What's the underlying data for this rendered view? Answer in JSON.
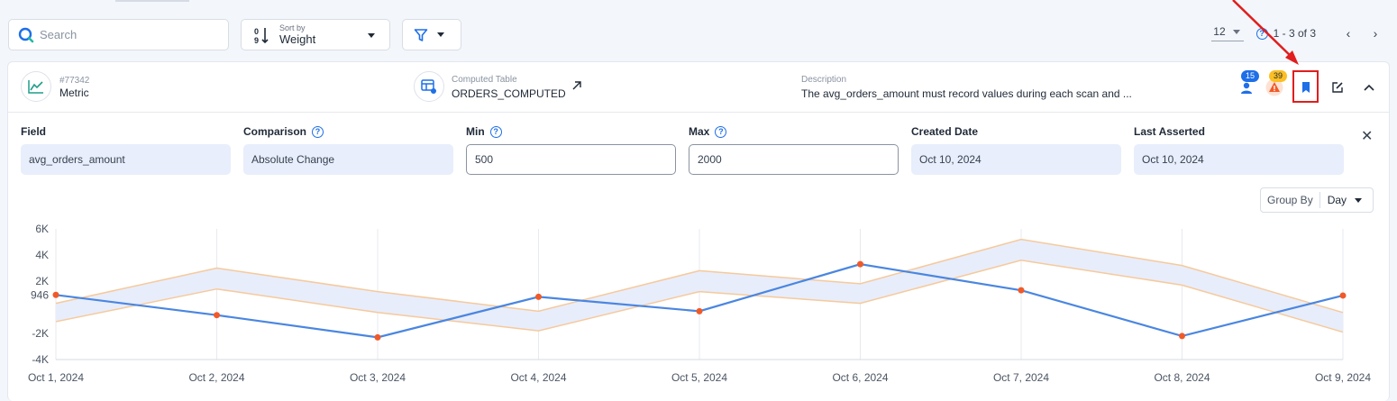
{
  "toolbar": {
    "search_placeholder": "Search",
    "sort_label": "Sort by",
    "sort_value": "Weight",
    "page_size": "12",
    "page_range": "1 - 3 of 3"
  },
  "check": {
    "id": "#77342",
    "type": "Metric",
    "table_label": "Computed Table",
    "table_name": "ORDERS_COMPUTED",
    "description_label": "Description",
    "description": "The avg_orders_amount must record values during each scan and ...",
    "tag_count": "15",
    "anomaly_count": "39"
  },
  "fields": {
    "field_label": "Field",
    "field_value": "avg_orders_amount",
    "comparison_label": "Comparison",
    "comparison_value": "Absolute Change",
    "min_label": "Min",
    "min_value": "500",
    "max_label": "Max",
    "max_value": "2000",
    "created_label": "Created Date",
    "created_value": "Oct 10, 2024",
    "asserted_label": "Last Asserted",
    "asserted_value": "Oct 10, 2024"
  },
  "group_by": {
    "label": "Group By",
    "value": "Day"
  },
  "colors": {
    "accent": "#1e6fe8",
    "line": "#4a86e0",
    "point": "#f05a28",
    "band_stroke": "#f6c99b",
    "band_fill": "#e8edfb",
    "highlight": "#e11d1d"
  },
  "chart_data": {
    "type": "line",
    "x": [
      "Oct 1, 2024",
      "Oct 2, 2024",
      "Oct 3, 2024",
      "Oct 4, 2024",
      "Oct 5, 2024",
      "Oct 6, 2024",
      "Oct 7, 2024",
      "Oct 8, 2024",
      "Oct 9, 2024"
    ],
    "y_ticks": [
      {
        "value": 6000,
        "label": "6K"
      },
      {
        "value": 4000,
        "label": "4K"
      },
      {
        "value": 2000,
        "label": "2K"
      },
      {
        "value": 946,
        "label": "946"
      },
      {
        "value": -2000,
        "label": "-2K"
      },
      {
        "value": -4000,
        "label": "-4K"
      }
    ],
    "ylim": [
      -4000,
      6000
    ],
    "series": [
      {
        "values": [
          946,
          -600,
          -2300,
          800,
          -300,
          3300,
          1300,
          -2200,
          900
        ]
      }
    ],
    "band_upper": [
      300,
      3000,
      1200,
      -300,
      2800,
      1800,
      5200,
      3200,
      -400
    ],
    "band_lower": [
      -1100,
      1400,
      -400,
      -1800,
      1200,
      300,
      3600,
      1700,
      -1900
    ],
    "grid": "vertical"
  }
}
